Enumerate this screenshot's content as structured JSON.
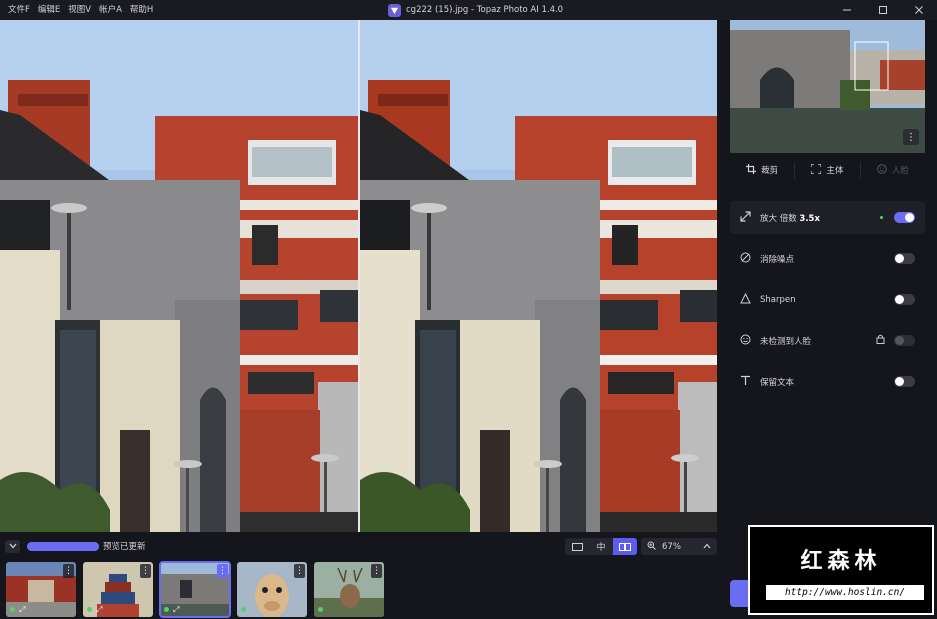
{
  "menu": [
    "文件F",
    "编辑E",
    "视图V",
    "帐户A",
    "帮助H"
  ],
  "window_title": "cg222 (15).jpg - Topaz Photo AI 1.4.0",
  "window_controls": [
    "minimize-icon",
    "maximize-icon",
    "close-icon"
  ],
  "bottombar": {
    "status": "预览已更新",
    "progress": 1.0,
    "view_modes": [
      "single",
      "split",
      "side-by-side"
    ],
    "view_mode_selected": "side-by-side",
    "split_glyph": "中",
    "zoom": "67%"
  },
  "thumbnails": [
    {
      "name": "courtyard-photo",
      "selected": false
    },
    {
      "name": "temple-photo",
      "selected": false
    },
    {
      "name": "building-photo",
      "selected": true
    },
    {
      "name": "giraffe-photo",
      "selected": false
    },
    {
      "name": "deer-photo",
      "selected": false
    }
  ],
  "panel": {
    "crop_label": "裁剪",
    "subject_label": "主体",
    "face_label": "人脸",
    "settings": [
      {
        "key": "upscale",
        "prefix": "放大 倍数 ",
        "value": "3.5x",
        "on": true
      },
      {
        "key": "denoise",
        "label": "消除噪点",
        "on": false
      },
      {
        "key": "sharpen",
        "label": "Sharpen",
        "on": false
      },
      {
        "key": "face",
        "label": "未检测到人脸",
        "on": false
      },
      {
        "key": "text",
        "label": "保留文本",
        "on": false
      }
    ]
  },
  "watermark": {
    "title": "红森林",
    "url": "http://www.hoslin.cn/"
  },
  "colors": {
    "accent": "#6a6cf2",
    "active_dot": "#4fd36a",
    "background": "#15161b"
  }
}
